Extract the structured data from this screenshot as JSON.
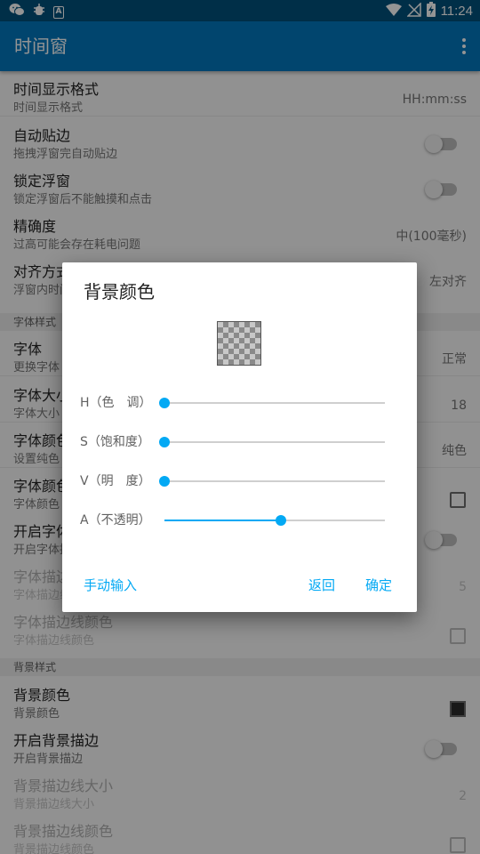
{
  "status_bar": {
    "time": "11:24"
  },
  "app_bar": {
    "title": "时间窗"
  },
  "settings": {
    "time_format": {
      "title": "时间显示格式",
      "subtitle": "时间显示格式",
      "value": "HH:mm:ss"
    },
    "auto_edge": {
      "title": "自动贴边",
      "subtitle": "拖拽浮窗完自动贴边",
      "checked": false
    },
    "lock_window": {
      "title": "锁定浮窗",
      "subtitle": "锁定浮窗后不能触摸和点击",
      "checked": false
    },
    "precision": {
      "title": "精确度",
      "subtitle": "过高可能会存在耗电问题",
      "value": "中(100毫秒)"
    },
    "alignment": {
      "title": "对齐方式",
      "subtitle": "浮窗内时间对齐方式",
      "value": "左对齐"
    },
    "font_section": "字体样式",
    "font": {
      "title": "字体",
      "subtitle": "更换字体",
      "value": "正常"
    },
    "font_size": {
      "title": "字体大小",
      "subtitle": "字体大小",
      "value": "18"
    },
    "font_color_mode": {
      "title": "字体颜色",
      "subtitle": "设置纯色",
      "value": "纯色"
    },
    "font_color": {
      "title": "字体颜色",
      "subtitle": "字体颜色"
    },
    "font_stroke": {
      "title": "开启字体描边",
      "subtitle": "开启字体描边",
      "checked": false
    },
    "font_stroke_size": {
      "title": "字体描边线大小",
      "subtitle": "字体描边线大小",
      "value": "5"
    },
    "font_stroke_color": {
      "title": "字体描边线颜色",
      "subtitle": "字体描边线颜色"
    },
    "bg_section": "背景样式",
    "bg_color": {
      "title": "背景颜色",
      "subtitle": "背景颜色"
    },
    "bg_stroke": {
      "title": "开启背景描边",
      "subtitle": "开启背景描边",
      "checked": false
    },
    "bg_stroke_size": {
      "title": "背景描边线大小",
      "subtitle": "背景描边线大小",
      "value": "2"
    },
    "bg_stroke_color": {
      "title": "背景描边线颜色",
      "subtitle": "背景描边线颜色"
    }
  },
  "dialog": {
    "title": "背景颜色",
    "sliders": [
      {
        "label": "H（色　调）",
        "value": 0.0
      },
      {
        "label": "S（饱和度）",
        "value": 0.0
      },
      {
        "label": "V（明　度）",
        "value": 0.0
      },
      {
        "label": "A（不透明）",
        "value": 0.53
      }
    ],
    "manual_input": "手动输入",
    "back": "返回",
    "confirm": "确定"
  },
  "colors": {
    "status_bar": "#01527d",
    "app_bar": "#0277bd",
    "accent": "#03a9f4",
    "scrim": "rgba(0,0,0,0.42)"
  },
  "icons": [
    "wechat-icon",
    "bug-icon",
    "a-badge-icon",
    "wifi-icon",
    "no-signal-icon",
    "battery-charging-icon",
    "more-vert-icon"
  ]
}
